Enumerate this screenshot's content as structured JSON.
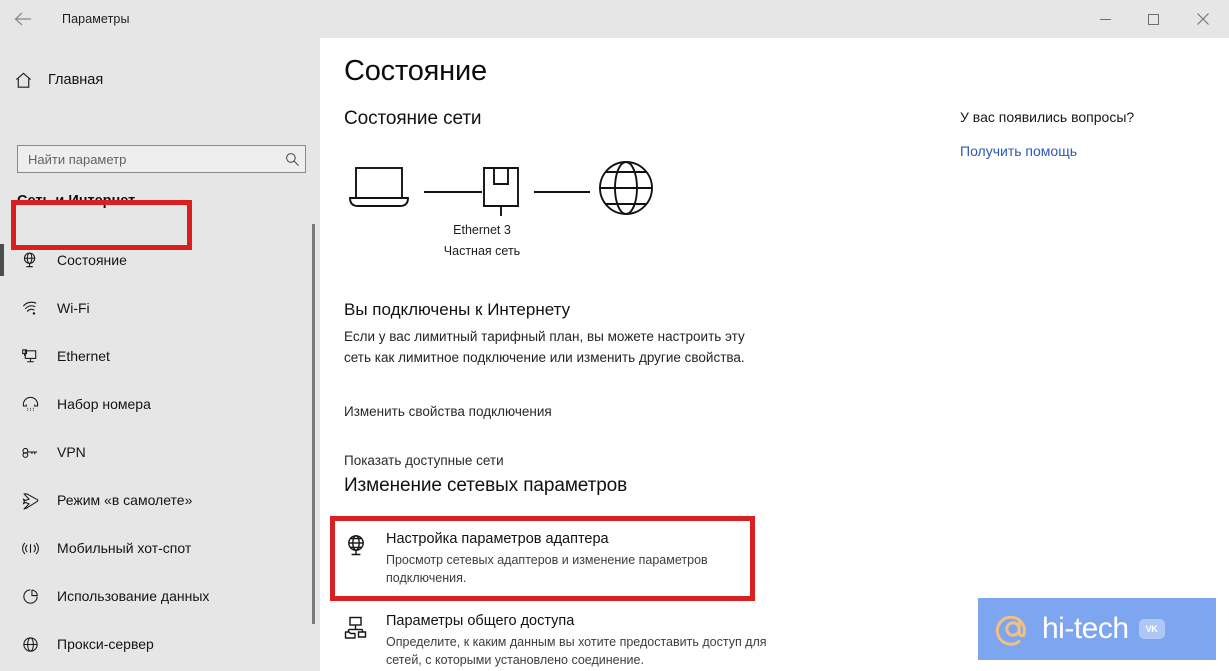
{
  "window": {
    "title": "Параметры",
    "back_icon": "back-arrow-icon",
    "minimize_label": "—",
    "maximize_label": "□",
    "close_label": "✕"
  },
  "sidebar": {
    "home": {
      "label": "Главная",
      "icon": "home-icon"
    },
    "search": {
      "placeholder": "Найти параметр",
      "value": "",
      "icon": "search-icon"
    },
    "section_title": "Сеть и Интернет",
    "items": [
      {
        "label": "Состояние",
        "icon": "globe-monitor-icon",
        "selected": true
      },
      {
        "label": "Wi-Fi",
        "icon": "wifi-icon",
        "selected": false
      },
      {
        "label": "Ethernet",
        "icon": "ethernet-monitor-icon",
        "selected": false
      },
      {
        "label": "Набор номера",
        "icon": "dialup-phone-icon",
        "selected": false
      },
      {
        "label": "VPN",
        "icon": "vpn-key-icon",
        "selected": false
      },
      {
        "label": "Режим «в самолете»",
        "icon": "airplane-icon",
        "selected": false
      },
      {
        "label": "Мобильный хот-спот",
        "icon": "hotspot-icon",
        "selected": false
      },
      {
        "label": "Использование данных",
        "icon": "data-usage-pie-icon",
        "selected": false
      },
      {
        "label": "Прокси-сервер",
        "icon": "globe-icon",
        "selected": false
      }
    ]
  },
  "main": {
    "page_title": "Состояние",
    "network_status_title": "Состояние сети",
    "diagram": {
      "device_icon": "laptop-icon",
      "adapter_icon": "ethernet-port-icon",
      "internet_icon": "globe-icon",
      "adapter_name": "Ethernet 3",
      "network_type": "Частная сеть"
    },
    "connection_heading": "Вы подключены к Интернету",
    "connection_description": "Если у вас лимитный тарифный план, вы можете настроить эту сеть как лимитное подключение или изменить другие свойства.",
    "link_change_properties": "Изменить свойства подключения",
    "link_show_networks": "Показать доступные сети",
    "network_change_title": "Изменение сетевых параметров",
    "options": [
      {
        "title": "Настройка параметров адаптера",
        "subtitle": "Просмотр сетевых адаптеров и изменение параметров подключения.",
        "icon": "network-adapter-icon",
        "highlighted": true
      },
      {
        "title": "Параметры общего доступа",
        "subtitle": "Определите, к каким данным вы хотите предоставить доступ для сетей, с которыми установлено соединение.",
        "icon": "sharing-folder-icon",
        "highlighted": false
      }
    ]
  },
  "help": {
    "title": "У вас появились вопросы?",
    "link": "Получить помощь"
  },
  "watermark": {
    "at_icon": "at-sign-icon",
    "text": "hi-tech",
    "badge": "VK"
  },
  "colors": {
    "highlight_red": "#d91f1f",
    "sidebar_bg": "#e6e6e6",
    "link_blue": "#2a59b5",
    "watermark_bg": "#7ea5f0",
    "watermark_at": "#f0c183"
  }
}
